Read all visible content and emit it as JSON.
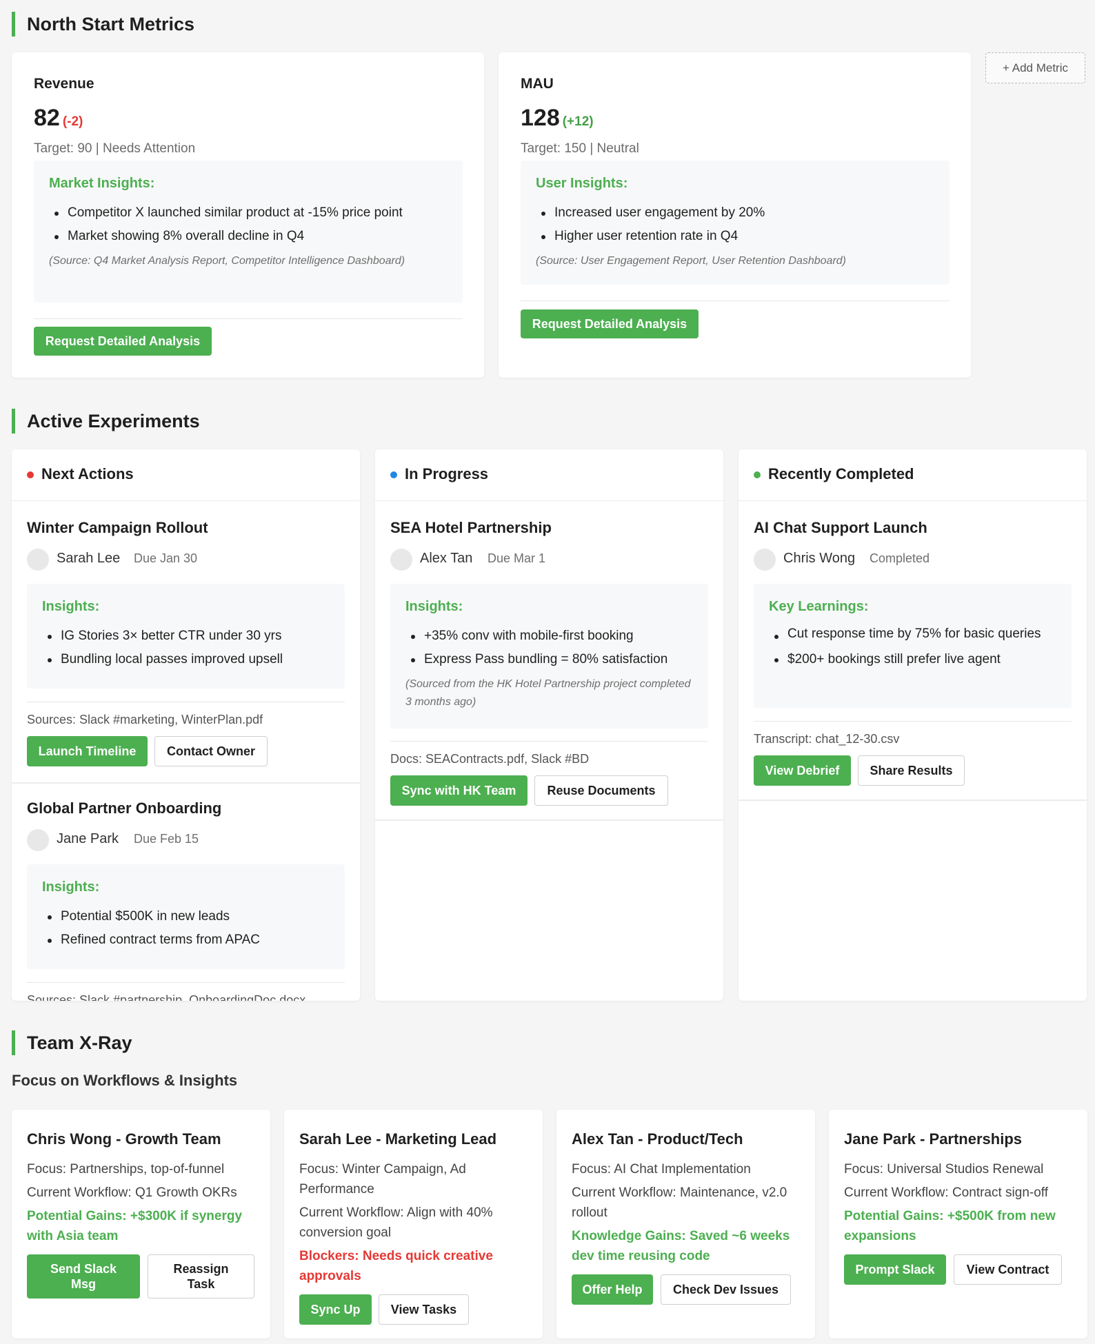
{
  "sections": {
    "metrics_title": "North Start Metrics",
    "experiments_title": "Active Experiments",
    "team_title": "Team X-Ray",
    "team_subtitle": "Focus on Workflows & Insights"
  },
  "add_metric_label": "+ Add Metric",
  "colors": {
    "green": "#4caf50",
    "red": "#e53935",
    "blue": "#1e88e5"
  },
  "metrics": [
    {
      "name": "Revenue",
      "value": "82",
      "delta": "(-2)",
      "target": "Target: 90 | Needs Attention",
      "insight_title": "Market Insights:",
      "insights": [
        "Competitor X launched similar product at -15% price point",
        "Market showing 8% overall decline in Q4"
      ],
      "source": "(Source: Q4 Market Analysis Report, Competitor Intelligence Dashboard)",
      "button": "Request Detailed Analysis"
    },
    {
      "name": "MAU",
      "value": "128",
      "delta": "(+12)",
      "target": "Target: 150 | Neutral",
      "insight_title": "User Insights:",
      "insights": [
        "Increased user engagement by 20%",
        "Higher user retention rate in Q4"
      ],
      "source": "(Source: User Engagement Report, User Retention Dashboard)",
      "button": "Request Detailed Analysis"
    }
  ],
  "columns": {
    "next": {
      "title": "Next Actions",
      "items": [
        {
          "title": "Winter Campaign Rollout",
          "owner": "Sarah Lee",
          "due": "Due Jan 30",
          "insight_title": "Insights:",
          "insights": [
            "IG Stories 3× better CTR under 30 yrs",
            "Bundling local passes improved upsell"
          ],
          "sources": "Sources: Slack #marketing, WinterPlan.pdf",
          "primary": "Launch Timeline",
          "secondary": "Contact Owner"
        },
        {
          "title": "Global Partner Onboarding",
          "owner": "Jane Park",
          "due": "Due Feb 15",
          "insight_title": "Insights:",
          "insights": [
            "Potential $500K in new leads",
            "Refined contract terms from APAC"
          ],
          "sources": "Sources: Slack #partnership, OnboardingDoc.docx"
        }
      ]
    },
    "progress": {
      "title": "In Progress",
      "item": {
        "title": "SEA Hotel Partnership",
        "owner": "Alex Tan",
        "due": "Due Mar 1",
        "insight_title": "Insights:",
        "insights": [
          "+35% conv with mobile-first booking",
          "Express Pass bundling = 80% satisfaction"
        ],
        "note": "(Sourced from the HK Hotel Partnership project completed 3 months ago)",
        "sources": "Docs: SEAContracts.pdf, Slack #BD",
        "primary": "Sync with HK Team",
        "secondary": "Reuse Documents"
      }
    },
    "done": {
      "title": "Recently Completed",
      "item": {
        "title": "AI Chat Support Launch",
        "owner": "Chris Wong",
        "due": "Completed",
        "insight_title": "Key Learnings:",
        "insights": [
          "Cut response time by 75% for basic queries",
          "$200+ bookings still prefer live agent"
        ],
        "sources": "Transcript: chat_12-30.csv",
        "primary": "View Debrief",
        "secondary": "Share Results"
      }
    }
  },
  "team": [
    {
      "name": "Chris Wong - Growth Team",
      "focus": "Focus: Partnerships, top-of-funnel",
      "workflow": "Current Workflow: Q1 Growth OKRs",
      "highlight": "Potential Gains: +$300K if synergy with Asia team",
      "primary": "Send Slack Msg",
      "secondary": "Reassign Task"
    },
    {
      "name": "Sarah Lee - Marketing Lead",
      "focus": "Focus: Winter Campaign, Ad Performance",
      "workflow": "Current Workflow: Align with 40% conversion goal",
      "highlight": "Blockers: Needs quick creative approvals",
      "primary": "Sync Up",
      "secondary": "View Tasks"
    },
    {
      "name": "Alex Tan - Product/Tech",
      "focus": "Focus: AI Chat Implementation",
      "workflow": "Current Workflow: Maintenance, v2.0 rollout",
      "highlight": "Knowledge Gains: Saved ~6 weeks dev time reusing code",
      "primary": "Offer Help",
      "secondary": "Check Dev Issues"
    },
    {
      "name": "Jane Park - Partnerships",
      "focus": "Focus: Universal Studios Renewal",
      "workflow": "Current Workflow: Contract sign-off",
      "highlight": "Potential Gains: +$500K from new expansions",
      "primary": "Prompt Slack",
      "secondary": "View Contract"
    }
  ]
}
